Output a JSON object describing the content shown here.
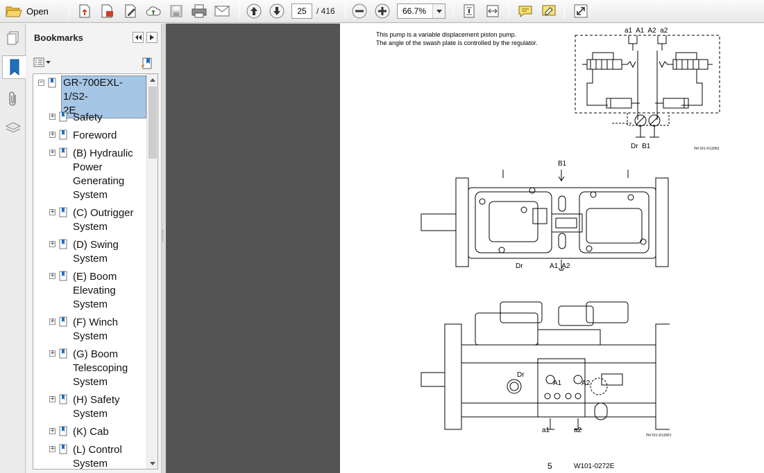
{
  "toolbar": {
    "open_label": "Open",
    "page_current": "25",
    "page_total": "/ 416",
    "zoom_value": "66.7%",
    "icons": [
      "folder-open-icon",
      "create-pdf-icon",
      "export-pdf-icon",
      "sign-icon",
      "upload-cloud-icon",
      "save-icon",
      "print-icon",
      "email-icon",
      "previous-page-icon",
      "next-page-icon",
      "zoom-out-icon",
      "zoom-in-icon",
      "fit-page-icon",
      "fit-width-icon",
      "comment-icon",
      "highlight-icon",
      "fullscreen-icon"
    ]
  },
  "sidebar": {
    "title": "Bookmarks",
    "tree": [
      {
        "label": "GR-700EXL-1/S2-2E",
        "lines": [
          "GR-700EXL-1/S2-",
          "2E"
        ],
        "expander": "−",
        "selected": true
      },
      {
        "label": "Safety",
        "lines": [
          "Safety"
        ],
        "expander": "+"
      },
      {
        "label": "Foreword",
        "lines": [
          "Foreword"
        ],
        "expander": "+"
      },
      {
        "label": "(B) Hydraulic Power Generating System",
        "lines": [
          "(B) Hydraulic",
          "Power",
          "Generating",
          "System"
        ],
        "expander": "+"
      },
      {
        "label": "(C) Outrigger System",
        "lines": [
          "(C) Outrigger",
          "System"
        ],
        "expander": "+"
      },
      {
        "label": "(D) Swing System",
        "lines": [
          "(D) Swing",
          "System"
        ],
        "expander": "+"
      },
      {
        "label": "(E) Boom Elevating System",
        "lines": [
          "(E) Boom",
          "Elevating",
          "System"
        ],
        "expander": "+"
      },
      {
        "label": "(F) Winch System",
        "lines": [
          "(F) Winch",
          "System"
        ],
        "expander": "+"
      },
      {
        "label": "(G) Boom Telescoping System",
        "lines": [
          "(G) Boom",
          "Telescoping",
          "System"
        ],
        "expander": "+"
      },
      {
        "label": "(H) Safety System",
        "lines": [
          "(H) Safety",
          "System"
        ],
        "expander": "+"
      },
      {
        "label": "(K) Cab",
        "lines": [
          "(K) Cab"
        ],
        "expander": "+"
      },
      {
        "label": "(L) Control System",
        "lines": [
          "(L) Control",
          "System"
        ],
        "expander": "+"
      }
    ]
  },
  "document": {
    "text_line_1": "This pump is a variable displacement piston pump.",
    "text_line_2": "The angle of the swash plate is controlled by the regulator.",
    "schematic_ports_top": "a1  A1  A2  a2",
    "schematic_ports_bottom": "Dr  B1",
    "schematic_code": "IW101-012002",
    "top_view": {
      "b1": "B1",
      "dr": "Dr",
      "a1a2": "A1  A2"
    },
    "side_view": {
      "dr": "Dr",
      "a1": "A1",
      "a2": "A2",
      "a1_low": "a1",
      "a2_low": "a2"
    },
    "drawing_code": "IW101-012001",
    "page_number": "5",
    "footer_code": "W101-0272E"
  }
}
